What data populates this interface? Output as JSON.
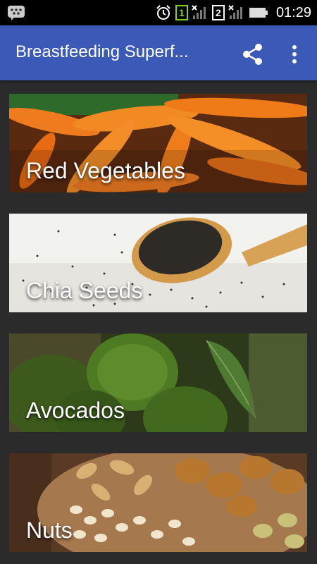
{
  "status_bar": {
    "time": "01:29",
    "sim1": "1",
    "sim2": "2",
    "icons": [
      "bbm-icon",
      "alarm-icon",
      "sim1-signal-icon",
      "sim2-signal-icon",
      "battery-icon"
    ]
  },
  "app_bar": {
    "title": "Breastfeeding Superf...",
    "share_icon": "share-icon",
    "menu_icon": "more-vert-icon",
    "color": "#3b5ab8"
  },
  "foods": [
    {
      "label": "Red Vegetables",
      "image": "carrots"
    },
    {
      "label": "Chia Seeds",
      "image": "chia-seeds-spoon"
    },
    {
      "label": "Avocados",
      "image": "avocados"
    },
    {
      "label": "Nuts",
      "image": "nuts"
    }
  ]
}
